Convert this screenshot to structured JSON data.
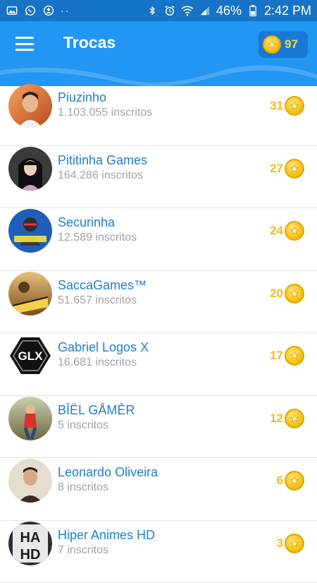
{
  "status_bar": {
    "battery": "46%",
    "time": "2:42 PM"
  },
  "header": {
    "title": "Trocas",
    "coins": "97"
  },
  "channels": [
    {
      "name": "Piuzinho",
      "subs": "1.103.055 inscritos",
      "points": "31",
      "avatar_color": "#d96b2c"
    },
    {
      "name": "Pititinha Games",
      "subs": "164.286 inscritos",
      "points": "27",
      "avatar_color": "#3b3b3b"
    },
    {
      "name": "Securinha",
      "subs": "12.589 inscritos",
      "points": "24",
      "avatar_color": "#1f5fb8"
    },
    {
      "name": "SaccaGames™",
      "subs": "51.657 inscritos",
      "points": "20",
      "avatar_color": "#c7892d"
    },
    {
      "name": "Gabriel Logos X",
      "subs": "16.681 inscritos",
      "points": "17",
      "avatar_color": "#111111"
    },
    {
      "name": "BĪËL GÅMĒR",
      "subs": "5 inscritos",
      "points": "12",
      "avatar_color": "#8b8e62"
    },
    {
      "name": "Leonardo Oliveira",
      "subs": "8 inscritos",
      "points": "6",
      "avatar_color": "#d8c6b0"
    },
    {
      "name": "Hiper Animes HD",
      "subs": "7 inscritos",
      "points": "3",
      "avatar_color": "#2a2f3a"
    }
  ],
  "avatar_texts": {
    "glx": "GLX",
    "ha": "HA",
    "hd": "HD"
  },
  "colors": {
    "primary": "#2196f3",
    "status_bar": "#1673c6",
    "name_text": "#1e7fc9",
    "points_text": "#f1bb1c"
  }
}
